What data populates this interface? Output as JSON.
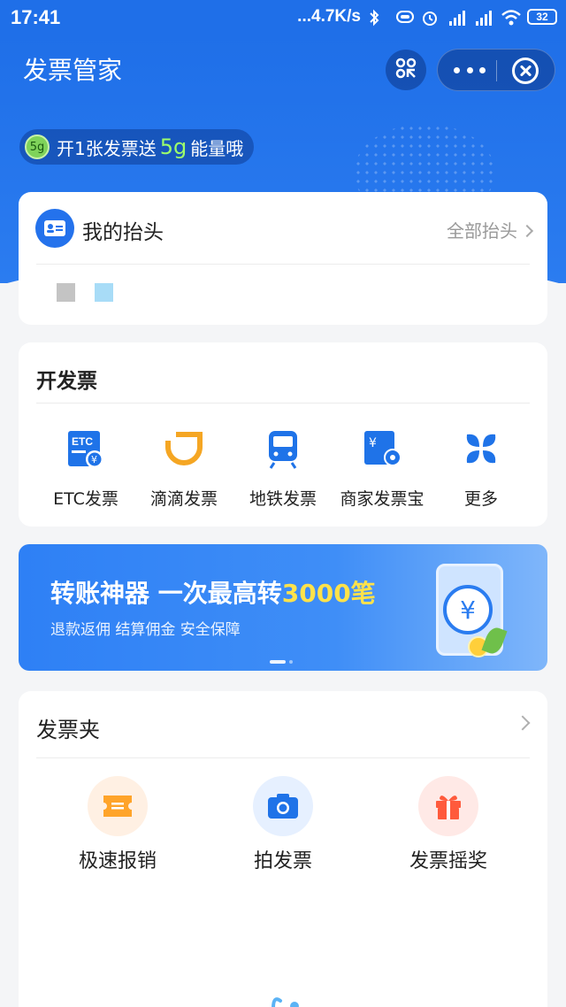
{
  "status_bar": {
    "time": "17:41",
    "network_speed": "...4.7K/s",
    "battery": "32",
    "icons": [
      "bluetooth-icon",
      "vibrate-icon",
      "alarm-icon",
      "signal-hd-icon",
      "signal-hd-icon",
      "wifi-icon",
      "battery-icon"
    ]
  },
  "header": {
    "title": "发票管家",
    "scan_icon": "scan-icon",
    "more_icon": "more-dots-icon",
    "close_icon": "close-circle-icon",
    "energy": {
      "badge": "5g",
      "text_before": "开1张发票送",
      "amount": "5g",
      "text_after": "能量哦"
    }
  },
  "my_title_card": {
    "label": "我的抬头",
    "all_link": "全部抬头"
  },
  "invoice_section": {
    "heading": "开发票",
    "services": [
      {
        "label": "ETC发票",
        "icon": "etc-icon"
      },
      {
        "label": "滴滴发票",
        "icon": "didi-icon"
      },
      {
        "label": "地铁发票",
        "icon": "metro-icon"
      },
      {
        "label": "商家发票宝",
        "icon": "merchant-invoice-icon"
      },
      {
        "label": "更多",
        "icon": "more-grid-icon"
      }
    ]
  },
  "banner": {
    "headline_part1": "转账神器 一次最高转",
    "headline_highlight": "3000笔",
    "subtitle": "退款返佣 结算佣金 安全保障",
    "coin_symbol": "¥"
  },
  "invoice_folder": {
    "heading": "发票夹",
    "items": [
      {
        "label": "极速报销",
        "icon": "ticket-icon"
      },
      {
        "label": "拍发票",
        "icon": "camera-icon"
      },
      {
        "label": "发票摇奖",
        "icon": "gift-icon"
      }
    ]
  },
  "colors": {
    "brand_blue": "#1f6fe8",
    "highlight_yellow": "#ffe24a",
    "energy_green": "#9dff6b",
    "didi_orange": "#f5a623"
  }
}
